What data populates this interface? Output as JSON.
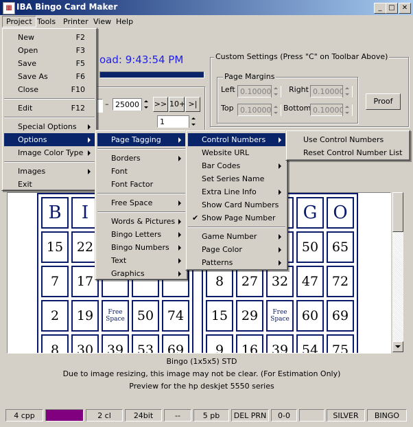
{
  "window": {
    "title": "IBA Bingo Card Maker"
  },
  "menubar": [
    "Project",
    "Tools",
    "Printer",
    "View",
    "Help"
  ],
  "clock_text": "oad: 9:43:54 PM",
  "range": {
    "to_value": "25000",
    "copies_value": "1",
    "btn_next": ">>",
    "btn_10": "10+",
    "btn_last": ">|"
  },
  "custom_settings": {
    "title": "Custom Settings  (Press \"C\" on Toolbar Above)",
    "margins_title": "Page Margins",
    "left_label": "Left",
    "left_value": "0.10000",
    "right_label": "Right",
    "right_value": "0.10000",
    "top_label": "Top",
    "top_value": "0.10000",
    "bottom_label": "Bottom",
    "bottom_value": "0.10000",
    "proof_label": "Proof"
  },
  "project_menu": [
    {
      "label": "New",
      "shortcut": "F2"
    },
    {
      "label": "Open",
      "shortcut": "F3"
    },
    {
      "label": "Save",
      "shortcut": "F5"
    },
    {
      "label": "Save As",
      "shortcut": "F6"
    },
    {
      "label": "Close",
      "shortcut": "F10"
    },
    {
      "label": "Edit",
      "shortcut": "F12"
    },
    {
      "label": "Special Options"
    },
    {
      "label": "Options"
    },
    {
      "label": "Image Color Type"
    },
    {
      "label": "Images"
    },
    {
      "label": "Exit"
    }
  ],
  "options_menu": [
    "Page Tagging",
    "Borders",
    "Font",
    "Font Factor",
    "Free Space",
    "Words & Pictures",
    "Bingo Letters",
    "Bingo Numbers",
    "Text",
    "Graphics"
  ],
  "tagging_menu": [
    "Control Numbers",
    "Website URL",
    "Bar Codes",
    "Set Series Name",
    "Extra Line Info",
    "Show Card Numbers",
    "Show Page Number",
    "Game Number",
    "Page Color",
    "Patterns"
  ],
  "control_menu": [
    "Use Control Numbers",
    "Reset Control Number List"
  ],
  "card_left": {
    "header": [
      "B",
      "I"
    ],
    "rows": [
      [
        "15",
        "22"
      ],
      [
        "7",
        "17"
      ],
      [
        "2",
        "19",
        "Free Space",
        "50",
        "74"
      ],
      [
        "8",
        "30",
        "39",
        "53",
        "69"
      ]
    ]
  },
  "card_right": {
    "header": [
      "G",
      "O"
    ],
    "rows": [
      [
        "50",
        "65"
      ],
      [
        "8",
        "27",
        "32",
        "47",
        "72"
      ],
      [
        "15",
        "29",
        "Free Space",
        "60",
        "69"
      ],
      [
        "9",
        "16",
        "39",
        "54",
        "75"
      ]
    ]
  },
  "info": {
    "line1": "Bingo (1x5x5) STD",
    "line2": "Due to image resizing, this image may not be clear.  (For Estimation Only)",
    "line3": "Preview for the hp deskjet 5550 series"
  },
  "statusbar": [
    "4 cpp",
    "",
    "2 cl",
    "24bit",
    "--",
    "5 pb",
    "DEL PRN",
    "0-0",
    "",
    "SILVER",
    "BINGO"
  ],
  "colors": {
    "titlebar": "#0a246a",
    "status_swatch": "#800080",
    "card_border": "#0a1a6a",
    "clock_text": "#1e1ee8"
  }
}
